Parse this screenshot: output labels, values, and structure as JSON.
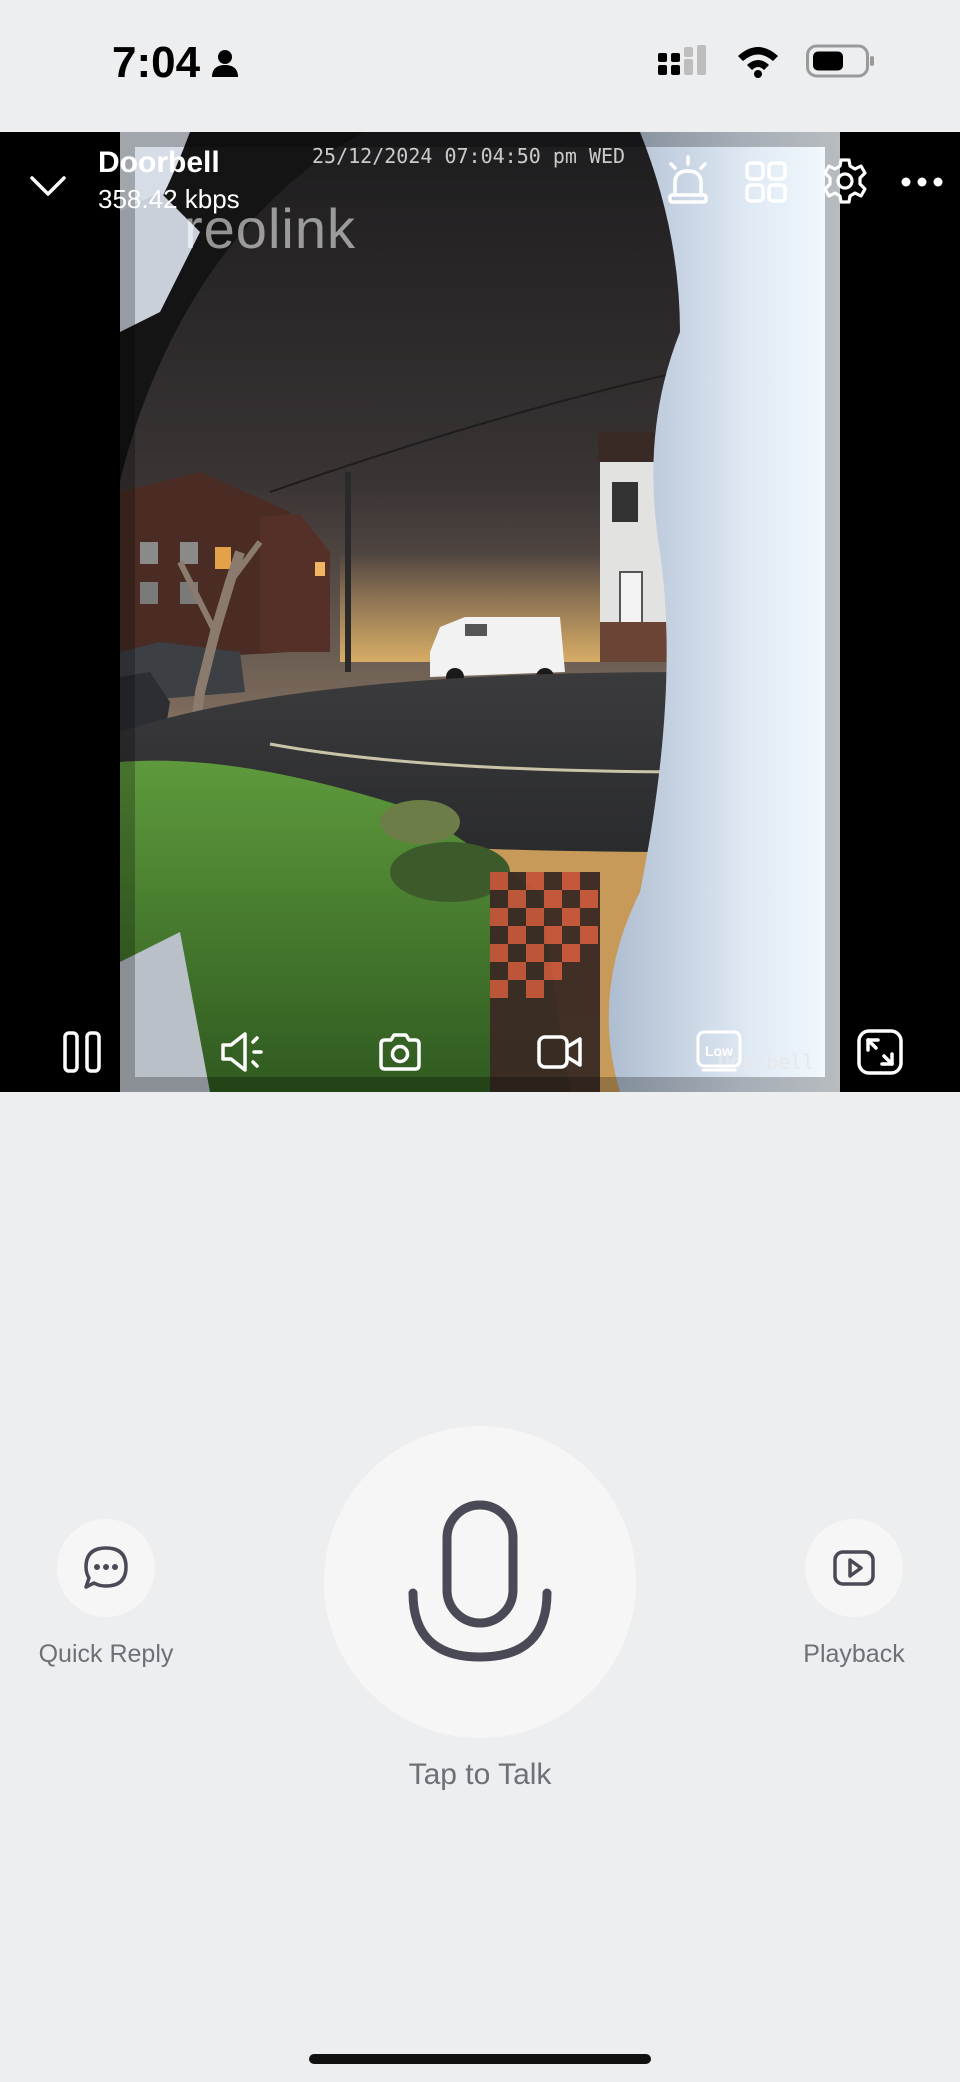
{
  "status_bar": {
    "time": "7:04",
    "accent": "#000000"
  },
  "camera": {
    "name": "Doorbell",
    "bitrate": "358.42 kbps",
    "osd_timestamp": "25/12/2024 07:04:50 pm WED",
    "osd_name": "Doorbell",
    "watermark": "reolink",
    "quality_badge": "Low"
  },
  "top_icons": [
    "collapse-chevron-icon",
    "siren-icon",
    "grid-view-icon",
    "settings-gear-icon",
    "more-icon"
  ],
  "bottom_icons": [
    "pause-icon",
    "speaker-icon",
    "snapshot-camera-icon",
    "record-video-icon",
    "quality-low-icon",
    "fullscreen-icon"
  ],
  "actions": {
    "quick_reply_label": "Quick Reply",
    "playback_label": "Playback",
    "talk_label": "Tap to Talk"
  },
  "colors": {
    "background": "#eceef0",
    "button_bg": "#f6f6f7",
    "label_gray": "#6e7078",
    "icon_dark": "#4a4a57"
  }
}
